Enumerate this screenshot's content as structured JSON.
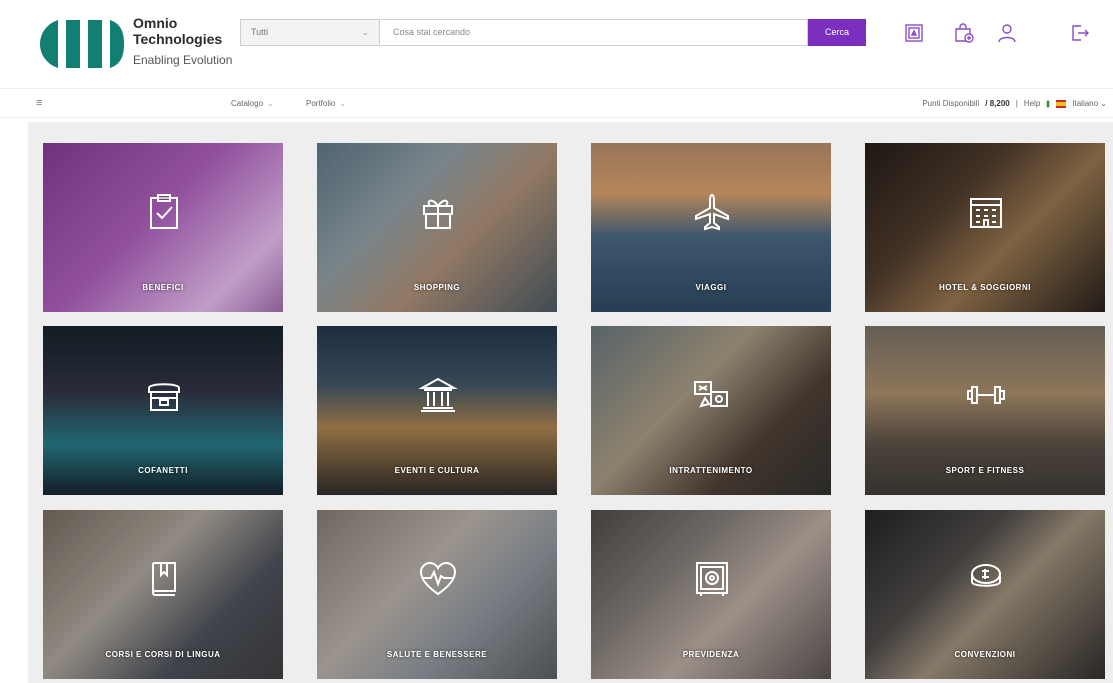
{
  "brand": {
    "name_line1": "Omnio",
    "name_line2": "Technologies",
    "tagline": "Enabling Evolution",
    "colors": {
      "logo": "#137e72",
      "accent": "#7b2fbf",
      "icon": "#8a4cc6"
    }
  },
  "search": {
    "category_value": "Tutti",
    "placeholder": "Cosa stai cercando",
    "button_label": "Cerca"
  },
  "header_icons": [
    "wishlist-icon",
    "shopping-bag-icon",
    "user-icon",
    "logout-icon"
  ],
  "nav": {
    "menu_icon": "menu-icon",
    "items": [
      {
        "label": "Catalogo"
      },
      {
        "label": "Portfolio"
      }
    ],
    "points_label": "Punti Disponibili",
    "points_value": "/ 8,200",
    "help_label": "Help",
    "language_label": "Italiano"
  },
  "tiles": [
    {
      "label": "BENEFICI",
      "icon": "clipboard-check-icon",
      "color": "#7a3f86"
    },
    {
      "label": "SHOPPING",
      "icon": "gift-icon",
      "color": "#7b8a95"
    },
    {
      "label": "VIAGGI",
      "icon": "airplane-icon",
      "color": "#3d5a72"
    },
    {
      "label": "HOTEL & SOGGIORNI",
      "icon": "hotel-building-icon",
      "color": "#4a3a30"
    },
    {
      "label": "COFANETTI",
      "icon": "gift-box-icon",
      "color": "#1f2e3c"
    },
    {
      "label": "EVENTI E CULTURA",
      "icon": "museum-icon",
      "color": "#3a4a55"
    },
    {
      "label": "INTRATTENIMENTO",
      "icon": "entertainment-icon",
      "color": "#4e5c60"
    },
    {
      "label": "SPORT E FITNESS",
      "icon": "dumbbell-icon",
      "color": "#6b6a60"
    },
    {
      "label": "CORSI E CORSI DI LINGUA",
      "icon": "book-icon",
      "color": "#6a6460"
    },
    {
      "label": "SALUTE E BENESSERE",
      "icon": "heart-pulse-icon",
      "color": "#8a8a8a"
    },
    {
      "label": "PREVIDENZA",
      "icon": "safe-icon",
      "color": "#6e6a68"
    },
    {
      "label": "CONVENZIONI",
      "icon": "coins-icon",
      "color": "#3a3a3a"
    }
  ]
}
